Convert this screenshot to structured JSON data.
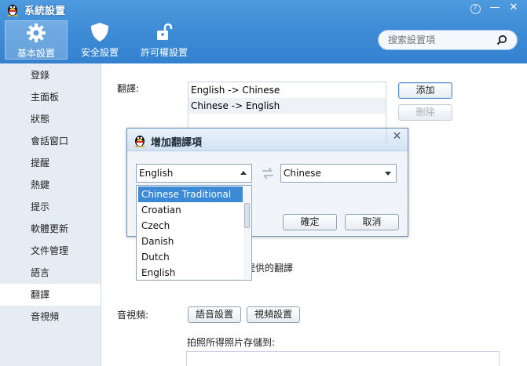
{
  "window": {
    "title": "系統設置",
    "help_label": "?",
    "minimize_label": "—",
    "close_label": "✕"
  },
  "toolbar": {
    "tabs": [
      {
        "label": "基本設置",
        "icon": "gear-icon",
        "active": true
      },
      {
        "label": "安全設置",
        "icon": "shield-icon",
        "active": false
      },
      {
        "label": "許可權設置",
        "icon": "padlock-icon",
        "active": false
      }
    ]
  },
  "search": {
    "placeholder": "搜索設置項",
    "icon": "search-icon"
  },
  "sidebar": {
    "items": [
      {
        "label": "登錄"
      },
      {
        "label": "主面板"
      },
      {
        "label": "狀態"
      },
      {
        "label": "會話窗口"
      },
      {
        "label": "提醒"
      },
      {
        "label": "熱鍵"
      },
      {
        "label": "提示"
      },
      {
        "label": "軟體更新"
      },
      {
        "label": "文件管理"
      },
      {
        "label": "語言"
      },
      {
        "label": "翻譯",
        "active": true
      },
      {
        "label": "音視頻"
      }
    ]
  },
  "main": {
    "translate_label": "翻譯:",
    "translate_list": [
      "English -> Chinese",
      "Chinese -> English"
    ],
    "add_button": "添加",
    "delete_button": "刪除",
    "provided_text": "提供的翻譯",
    "av_label": "音視頻:",
    "voice_button": "語音設置",
    "video_button": "視頻設置",
    "photo_label": "拍照所得照片存儲到:"
  },
  "dialog": {
    "title": "增加翻譯項",
    "close_label": "✕",
    "source_value": "English",
    "target_value": "Chinese",
    "confirm_button": "確定",
    "cancel_button": "取消"
  },
  "dropdown": {
    "options": [
      "Chinese Traditional",
      "Croatian",
      "Czech",
      "Danish",
      "Dutch",
      "English"
    ],
    "selected_index": 0
  },
  "colors": {
    "header_blue": "#3f8dd7",
    "selection_blue": "#3c8ad6",
    "sidebar_bg": "#e5ecf3"
  }
}
